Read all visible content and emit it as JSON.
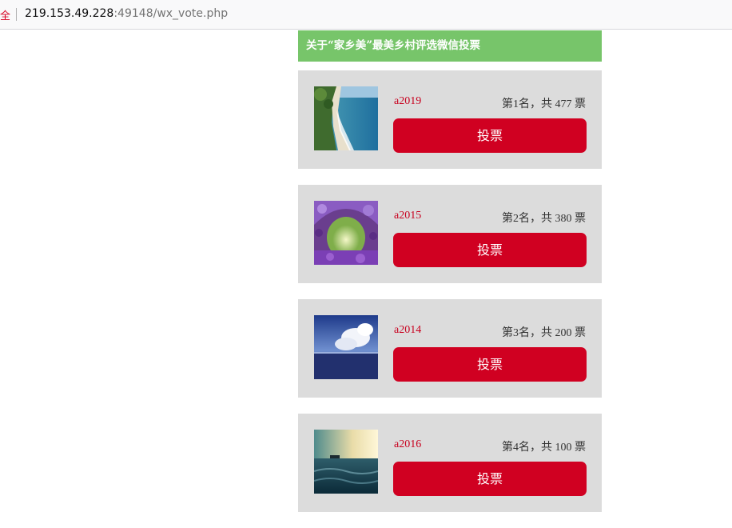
{
  "browser": {
    "secure_label": "全",
    "url_host": "219.153.49.228",
    "url_rest": ":49148/wx_vote.php"
  },
  "page": {
    "title": "关于“家乡美”最美乡村评选微信投票"
  },
  "candidates": [
    {
      "name": "a2019",
      "rank_text": "第1名，共 477 票",
      "vote_label": "投票",
      "image": "coastline-photo"
    },
    {
      "name": "a2015",
      "rank_text": "第2名，共 380 票",
      "vote_label": "投票",
      "image": "flower-tunnel-photo"
    },
    {
      "name": "a2014",
      "rank_text": "第3名，共 200 票",
      "vote_label": "投票",
      "image": "sky-sea-photo"
    },
    {
      "name": "a2016",
      "rank_text": "第4名，共 100 票",
      "vote_label": "投票",
      "image": "ocean-boat-photo"
    }
  ]
}
